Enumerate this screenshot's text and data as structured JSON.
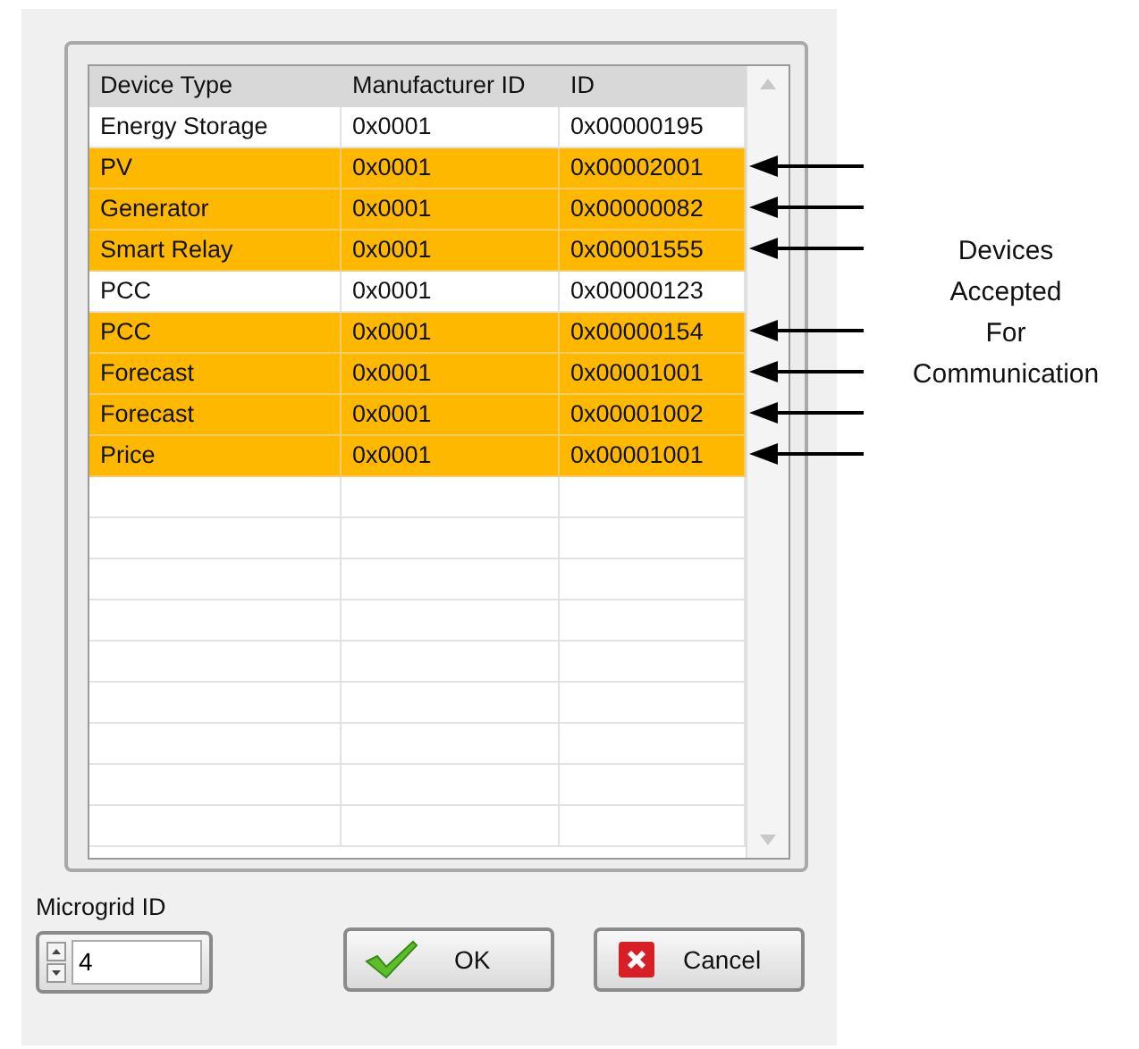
{
  "table": {
    "columns": [
      "Device Type",
      "Manufacturer ID",
      "ID"
    ],
    "rows": [
      {
        "cells": [
          "Energy Storage",
          "0x0001",
          "0x00000195"
        ],
        "highlighted": false
      },
      {
        "cells": [
          "PV",
          "0x0001",
          "0x00002001"
        ],
        "highlighted": true
      },
      {
        "cells": [
          "Generator",
          "0x0001",
          "0x00000082"
        ],
        "highlighted": true
      },
      {
        "cells": [
          "Smart Relay",
          "0x0001",
          "0x00001555"
        ],
        "highlighted": true
      },
      {
        "cells": [
          "PCC",
          "0x0001",
          "0x00000123"
        ],
        "highlighted": false
      },
      {
        "cells": [
          "PCC",
          "0x0001",
          "0x00000154"
        ],
        "highlighted": true
      },
      {
        "cells": [
          "Forecast",
          "0x0001",
          "0x00001001"
        ],
        "highlighted": true
      },
      {
        "cells": [
          "Forecast",
          "0x0001",
          "0x00001002"
        ],
        "highlighted": true
      },
      {
        "cells": [
          "Price",
          "0x0001",
          "0x00001001"
        ],
        "highlighted": true
      }
    ]
  },
  "microgrid_id": {
    "label": "Microgrid ID",
    "value": "4"
  },
  "buttons": [
    {
      "kind": "ok",
      "label": "OK"
    },
    {
      "kind": "cancel",
      "label": "Cancel"
    }
  ],
  "annotation": {
    "lines": [
      "Devices",
      "Accepted",
      "For",
      "Communication"
    ]
  }
}
